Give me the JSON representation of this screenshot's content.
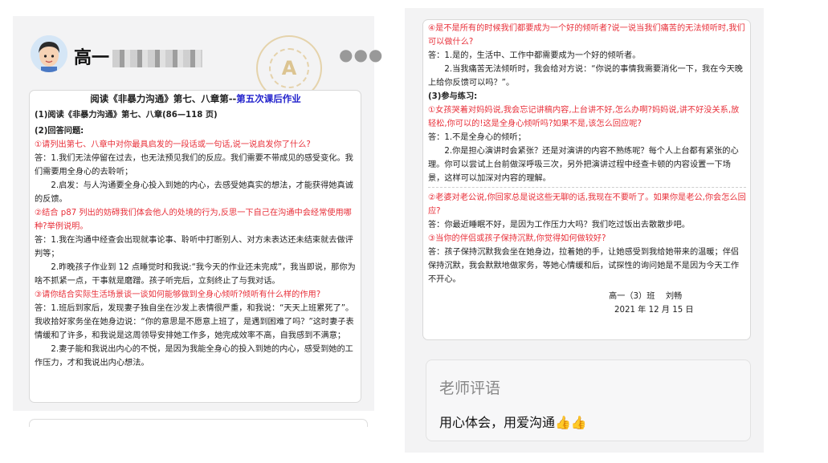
{
  "header": {
    "user_name": "高一",
    "more_icon": "more-dots-icon",
    "seal_letter": "A"
  },
  "left_doc": {
    "title_main": "阅读《非暴力沟通》第七、八章第--",
    "title_highlight": "第五次课后作业",
    "section1": "(1)阅读《非暴力沟通》第七、八章(86—118 页)",
    "section2": "(2)回答问题:",
    "q1": "①请列出第七、八章中对你最具启发的一段话或一句话,说一说启发你了什么?",
    "a1_1": "答：1.我们无法停留在过去，也无法预见我们的反应。我们需要不带成见的感受变化。我们需要用全身心的去聆听；",
    "a1_2": "2.启发：与人沟通要全身心投入到她的内心，去感受她真实的想法，才能获得她真诚的反馈。",
    "q2": "②结合 p87 列出的妨碍我们体会他人的处境的行为,反思一下自己在沟通中会经常使用哪种?举例说明。",
    "a2_1": "答：1.我在沟通中经查会出现就事论事、聆听中打断别人、对方未表达还未结束就去做评判等；",
    "a2_2": "2.昨晚孩子作业到 12 点睡觉时和我说:“我今天的作业还未完成”，我当即说，那你为啥不抓紧一点，干事就是磨蹭。孩子听完后，立刻终止了与我对话。",
    "q3": "③请你结合实际生活场景谈一谈如何能够做到全身心倾听?倾听有什么样的作用?",
    "a3_1": "答：1.班后到家后，发现妻子独自坐在沙发上表情很严重，和我说：“天天上班累死了”。我收拾好家务坐在她身边说：“你的意思是不愿意上班了，是遇到困难了吗？”这时妻子表情缓和了许多，和我说是这周领导安排她工作多，她完成效率不高，自我感到不满意；",
    "a3_2": "2.妻子能和我说出内心的不悦，是因为我能全身心的投入到她的内心，感受到她的工作压力，才和我说出内心想法。"
  },
  "right_doc": {
    "q4": "④是不是所有的时候我们都要成为一个好的倾听者?说一说当我们痛苦的无法倾听时,我们可以做什么?",
    "a4_1": "答：1.是的，生活中、工作中都需要成为一个好的倾听者。",
    "a4_2": "2.当我痛苦无法倾听时，我会给对方说：“你说的事情我需要消化一下，我在今天晚上给你反馈可以吗？”。",
    "section3": "(3)参与练习:",
    "e1": "①女孩哭着对妈妈说,我会忘记讲稿内容,上台讲不好,怎么办啊?妈妈说,讲不好没关系,放轻松,你可以的!这是全身心倾听吗?如果不是,该怎么回应呢?",
    "e1_a1": "答：1.不是全身心的倾听；",
    "e1_a2": "2.你是担心演讲时会紧张？还是对演讲的内容不熟练呢？每个人上台都有紧张的心理。你可以尝试上台前做深呼吸三次，另外把演讲过程中经查卡顿的内容设置一下场景，这样可以加深对内容的理解。",
    "e2": "②老婆对老公说,你回家总是说这些无聊的话,我现在不要听了。如果你是老公,你会怎么回应?",
    "e2_a": "答：你最近睡眠不好，是因为工作压力大吗？我们吃过饭出去散散步吧。",
    "e3": "③当你的伴侣或孩子保持沉默,你觉得如何做较好?",
    "e3_a": "答：孩子保持沉默我会坐在她身边，拉着她的手，让她感受到我给她带来的温暖；伴侣保持沉默，我会默默地做家务，等她心情缓和后，试探性的询问她是不是因为今天工作不开心。",
    "signature": "高一（3）班　 刘畅",
    "date": "2021 年 12 月 15 日"
  },
  "teacher_comment": {
    "title": "老师评语",
    "text": "用心体会，用爱沟通👍👍"
  }
}
